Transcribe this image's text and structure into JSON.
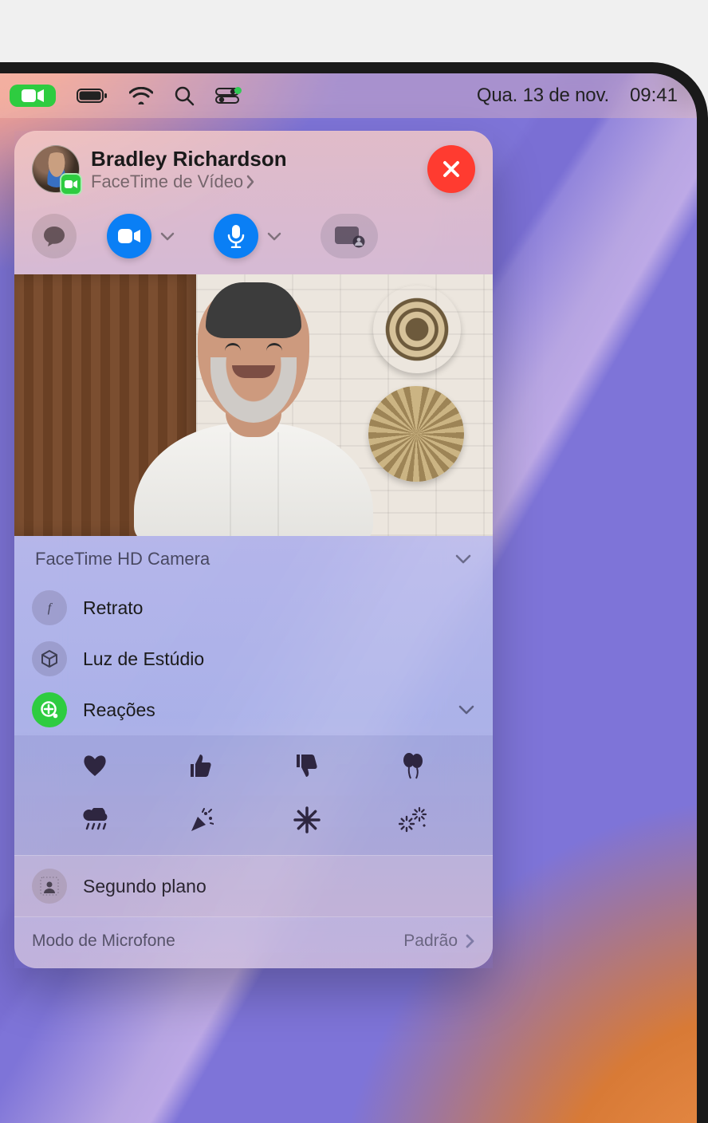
{
  "menubar": {
    "date": "Qua. 13 de nov.",
    "time": "09:41"
  },
  "call": {
    "name": "Bradley Richardson",
    "type_label": "FaceTime de Vídeo"
  },
  "camera": {
    "name": "FaceTime HD Camera",
    "options": {
      "portrait": "Retrato",
      "studio_light": "Luz de Estúdio",
      "reactions": "Reações"
    },
    "background": "Segundo plano"
  },
  "reactions_icons": [
    "heart",
    "thumbs-up",
    "thumbs-down",
    "balloons",
    "rain",
    "party-popper",
    "burst",
    "fireworks"
  ],
  "microphone": {
    "label": "Modo de Microfone",
    "value": "Padrão"
  }
}
